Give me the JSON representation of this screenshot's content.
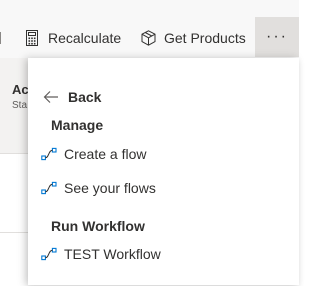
{
  "toolbar": {
    "recalculate_label": "Recalculate",
    "recalculate_icon": "calculator-icon",
    "get_products_label": "Get Products",
    "get_products_icon": "box-icon",
    "more_label": "···",
    "more_icon": "more-icon"
  },
  "form": {
    "title_fragment": "Ac",
    "subtitle_fragment": "Sta"
  },
  "flyout": {
    "back_label": "Back",
    "back_icon": "back-arrow-icon",
    "sections": [
      {
        "heading": "Manage",
        "items": [
          {
            "label": "Create a flow",
            "icon": "flow-icon"
          },
          {
            "label": "See your flows",
            "icon": "flow-icon"
          }
        ]
      },
      {
        "heading": "Run Workflow",
        "items": [
          {
            "label": "TEST Workflow",
            "icon": "flow-icon"
          }
        ]
      }
    ]
  },
  "colors": {
    "toolbar_bg": "#f8f8f8",
    "more_button_bg": "#e1dfdd",
    "icon_blue": "#0078d4",
    "text": "#323130"
  }
}
